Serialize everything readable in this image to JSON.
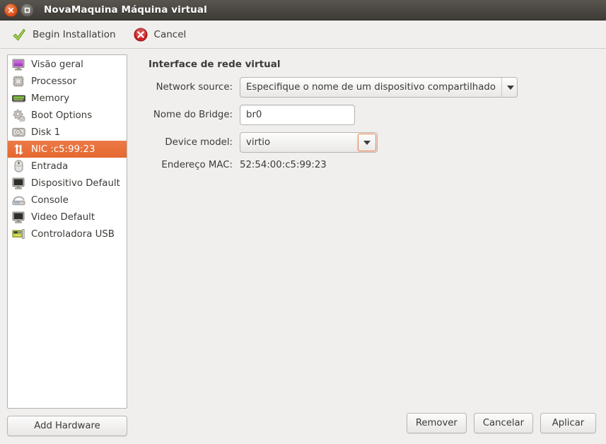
{
  "window": {
    "title": "NovaMaquina Máquina virtual",
    "close_icon": "close-icon",
    "maximize_icon": "maximize-icon"
  },
  "toolbar": {
    "items": [
      {
        "label": "Begin Installation",
        "icon": "checkmark-icon"
      },
      {
        "label": "Cancel",
        "icon": "cancel-circle-icon"
      }
    ]
  },
  "sidebar": {
    "items": [
      {
        "label": "Visão geral",
        "icon": "monitor-overview-icon",
        "selected": false
      },
      {
        "label": "Processor",
        "icon": "cpu-chip-icon",
        "selected": false
      },
      {
        "label": "Memory",
        "icon": "memory-stick-icon",
        "selected": false
      },
      {
        "label": "Boot Options",
        "icon": "gears-icon",
        "selected": false
      },
      {
        "label": "Disk 1",
        "icon": "hard-disk-icon",
        "selected": false
      },
      {
        "label": "NIC :c5:99:23",
        "icon": "network-arrows-icon",
        "selected": true
      },
      {
        "label": "Entrada",
        "icon": "mouse-icon",
        "selected": false
      },
      {
        "label": "Dispositivo Default",
        "icon": "display-icon",
        "selected": false
      },
      {
        "label": "Console",
        "icon": "console-icon",
        "selected": false
      },
      {
        "label": "Video Default",
        "icon": "display-icon",
        "selected": false
      },
      {
        "label": "Controladora USB",
        "icon": "usb-card-icon",
        "selected": false
      }
    ],
    "add_hardware_label": "Add Hardware"
  },
  "main": {
    "panel_title": "Interface de rede virtual",
    "fields": {
      "network_source": {
        "label": "Network source:",
        "value": "Especifique o nome de um dispositivo compartilhado"
      },
      "bridge_name": {
        "label": "Nome do Bridge:",
        "value": "br0",
        "placeholder": ""
      },
      "device_model": {
        "label": "Device model:",
        "value": "virtio"
      },
      "mac_address": {
        "label": "Endereço MAC:",
        "value": "52:54:00:c5:99:23"
      }
    }
  },
  "footer": {
    "buttons": [
      {
        "label": "Remover"
      },
      {
        "label": "Cancelar"
      },
      {
        "label": "Aplicar"
      }
    ]
  },
  "colors": {
    "selection_orange": "#e4672f",
    "titlebar_dark": "#4b4843",
    "background": "#f0efee",
    "focus_orange": "#e68a55"
  }
}
